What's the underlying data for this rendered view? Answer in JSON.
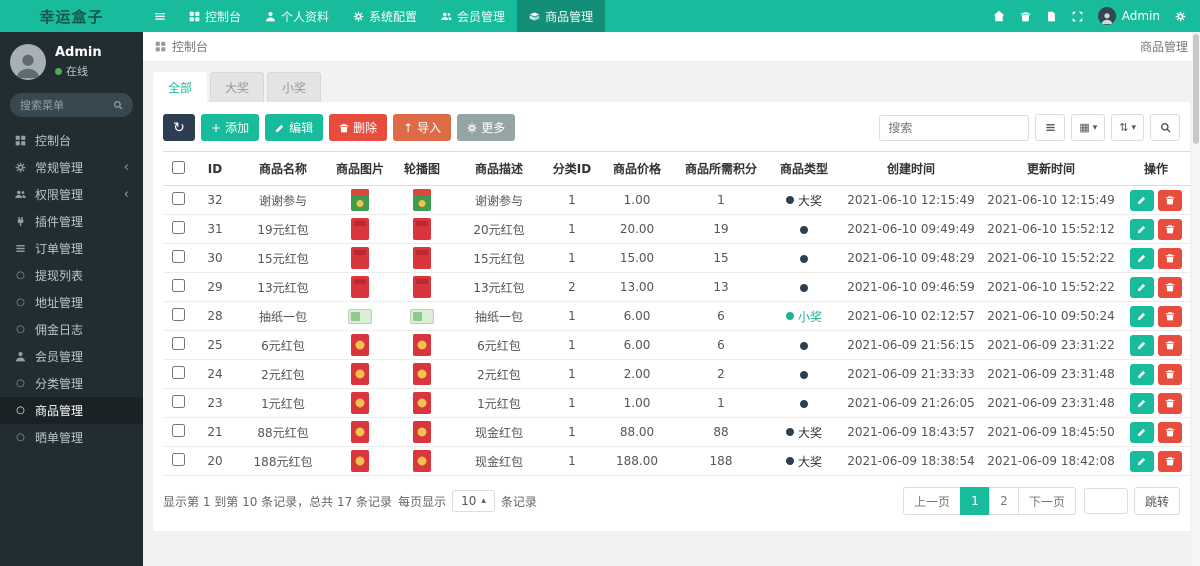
{
  "navbar": {
    "logo": "幸运盒子",
    "items": [
      {
        "label": "控制台"
      },
      {
        "label": "个人资料"
      },
      {
        "label": "系统配置"
      },
      {
        "label": "会员管理"
      },
      {
        "label": "商品管理",
        "active": true
      }
    ],
    "user_name": "Admin"
  },
  "sidebar": {
    "user": {
      "name": "Admin",
      "status": "在线"
    },
    "search_placeholder": "搜索菜单",
    "menu": [
      {
        "label": "控制台"
      },
      {
        "label": "常规管理",
        "has_children": true
      },
      {
        "label": "权限管理",
        "has_children": true
      },
      {
        "label": "插件管理"
      },
      {
        "label": "订单管理"
      },
      {
        "label": "提现列表"
      },
      {
        "label": "地址管理"
      },
      {
        "label": "佣金日志"
      },
      {
        "label": "会员管理"
      },
      {
        "label": "分类管理"
      },
      {
        "label": "商品管理",
        "active": true
      },
      {
        "label": "晒单管理"
      }
    ]
  },
  "breadcrumb": {
    "left": "控制台",
    "right": "商品管理"
  },
  "tabs": [
    {
      "label": "全部",
      "active": true
    },
    {
      "label": "大奖"
    },
    {
      "label": "小奖"
    }
  ],
  "toolbar": {
    "add": "添加",
    "edit": "编辑",
    "delete": "删除",
    "import": "导入",
    "more": "更多",
    "search_placeholder": "搜索"
  },
  "table": {
    "columns": [
      "ID",
      "商品名称",
      "商品图片",
      "轮播图",
      "商品描述",
      "分类ID",
      "商品价格",
      "商品所需积分",
      "商品类型",
      "创建时间",
      "更新时间",
      "操作"
    ],
    "rows": [
      {
        "id": "32",
        "name": "谢谢参与",
        "image": "thanks",
        "carousel": "thanks",
        "desc": "谢谢参与",
        "category_id": "1",
        "price": "1.00",
        "points": "1",
        "type": "大奖",
        "type_color": "dark",
        "create_time": "2021-06-10 12:15:49",
        "update_time": "2021-06-10 12:15:49"
      },
      {
        "id": "31",
        "name": "19元红包",
        "image": "red",
        "carousel": "red",
        "desc": "20元红包",
        "category_id": "1",
        "price": "20.00",
        "points": "19",
        "type": "",
        "type_color": "dark",
        "create_time": "2021-06-10 09:49:49",
        "update_time": "2021-06-10 15:52:12"
      },
      {
        "id": "30",
        "name": "15元红包",
        "image": "red",
        "carousel": "red",
        "desc": "15元红包",
        "category_id": "1",
        "price": "15.00",
        "points": "15",
        "type": "",
        "type_color": "dark",
        "create_time": "2021-06-10 09:48:29",
        "update_time": "2021-06-10 15:52:22"
      },
      {
        "id": "29",
        "name": "13元红包",
        "image": "red",
        "carousel": "red",
        "desc": "13元红包",
        "category_id": "2",
        "price": "13.00",
        "points": "13",
        "type": "",
        "type_color": "dark",
        "create_time": "2021-06-10 09:46:59",
        "update_time": "2021-06-10 15:52:22"
      },
      {
        "id": "28",
        "name": "抽纸一包",
        "image": "tissue",
        "carousel": "tissue",
        "desc": "抽纸一包",
        "category_id": "1",
        "price": "6.00",
        "points": "6",
        "type": "小奖",
        "type_color": "green",
        "create_time": "2021-06-10 02:12:57",
        "update_time": "2021-06-10 09:50:24"
      },
      {
        "id": "25",
        "name": "6元红包",
        "image": "red-gold",
        "carousel": "red-gold",
        "desc": "6元红包",
        "category_id": "1",
        "price": "6.00",
        "points": "6",
        "type": "",
        "type_color": "dark",
        "create_time": "2021-06-09 21:56:15",
        "update_time": "2021-06-09 23:31:22"
      },
      {
        "id": "24",
        "name": "2元红包",
        "image": "red-gold",
        "carousel": "red-gold",
        "desc": "2元红包",
        "category_id": "1",
        "price": "2.00",
        "points": "2",
        "type": "",
        "type_color": "dark",
        "create_time": "2021-06-09 21:33:33",
        "update_time": "2021-06-09 23:31:48"
      },
      {
        "id": "23",
        "name": "1元红包",
        "image": "red-gold",
        "carousel": "red-gold",
        "desc": "1元红包",
        "category_id": "1",
        "price": "1.00",
        "points": "1",
        "type": "",
        "type_color": "dark",
        "create_time": "2021-06-09 21:26:05",
        "update_time": "2021-06-09 23:31:48"
      },
      {
        "id": "21",
        "name": "88元红包",
        "image": "red-gold",
        "carousel": "red-gold",
        "desc": "现金红包",
        "category_id": "1",
        "price": "88.00",
        "points": "88",
        "type": "大奖",
        "type_color": "dark",
        "create_time": "2021-06-09 18:43:57",
        "update_time": "2021-06-09 18:45:50"
      },
      {
        "id": "20",
        "name": "188元红包",
        "image": "red-gold",
        "carousel": "red-gold",
        "desc": "现金红包",
        "category_id": "1",
        "price": "188.00",
        "points": "188",
        "type": "大奖",
        "type_color": "dark",
        "create_time": "2021-06-09 18:38:54",
        "update_time": "2021-06-09 18:42:08"
      }
    ]
  },
  "footer": {
    "info": "显示第 1 到第 10 条记录，总共 17 条记录",
    "per_page_label": "每页显示",
    "per_page_value": "10",
    "per_page_suffix": "条记录",
    "pagination": {
      "prev": "上一页",
      "pages": [
        "1",
        "2"
      ],
      "active_page": "1",
      "next": "下一页",
      "jump": "跳转"
    }
  },
  "colors": {
    "brand_teal": "#18bc9c",
    "navbar_active": "#128f76",
    "sidebar_bg": "#222d32",
    "sidebar_active_bg": "#1a2226",
    "dark_button": "#2c3e50",
    "danger_red": "#e74c3c",
    "import_orange": "#dd6b45",
    "more_gray": "#95a5a6",
    "small_prize_green": "#1ab394",
    "online_green": "#4caf50"
  }
}
